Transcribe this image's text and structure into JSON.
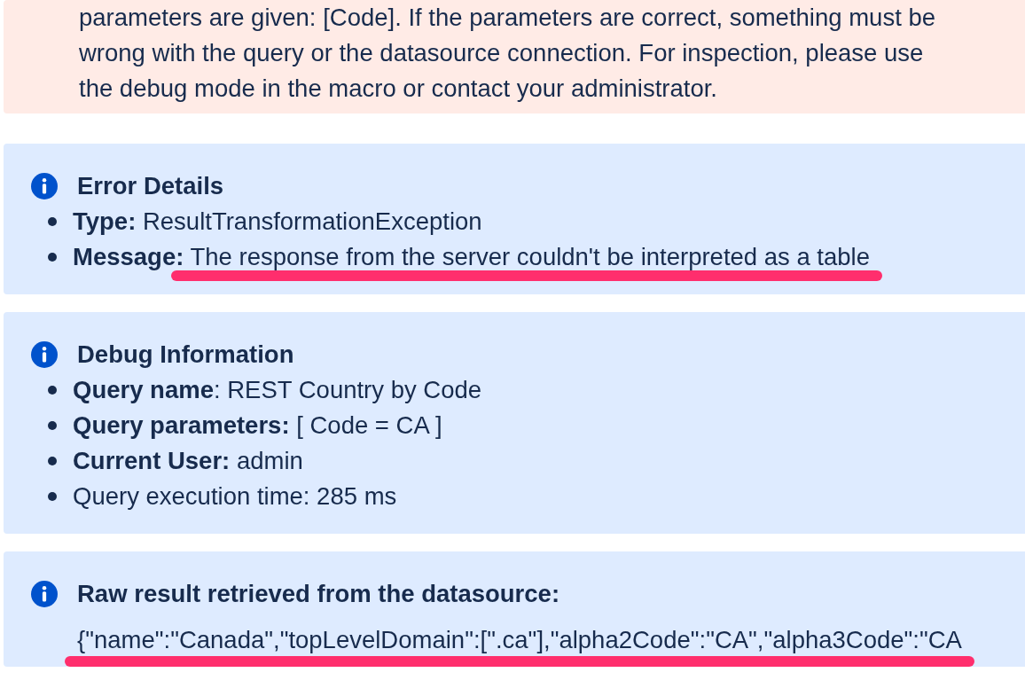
{
  "error_notice": {
    "lines": [
      "parameters are given: [Code]. If the parameters are correct, something must be",
      "wrong with the query or the datasource connection. For inspection, please use",
      "the debug mode in the macro or contact your administrator."
    ]
  },
  "panels": [
    {
      "kind": "list",
      "title": "Error Details",
      "items": [
        {
          "label": "Type:",
          "value": " ResultTransformationException",
          "highlighted": false
        },
        {
          "label": "Message:",
          "value": " The response from the server couldn't be interpreted as a table",
          "highlighted": true
        }
      ]
    },
    {
      "kind": "list",
      "title": "Debug Information",
      "items": [
        {
          "label": "Query name",
          "value": ": REST Country by Code",
          "highlighted": false
        },
        {
          "label": "Query parameters:",
          "value": " [ Code = CA ]",
          "highlighted": false
        },
        {
          "label": "Current User:",
          "value": " admin",
          "highlighted": false
        },
        {
          "value": "Query execution time: 285 ms",
          "highlighted": false
        }
      ]
    },
    {
      "kind": "raw",
      "title": "Raw result retrieved from the datasource:",
      "content": "{\"name\":\"Canada\",\"topLevelDomain\":[\".ca\"],\"alpha2Code\":\"CA\",\"alpha3Code\":\"CA",
      "highlighted": true
    }
  ]
}
